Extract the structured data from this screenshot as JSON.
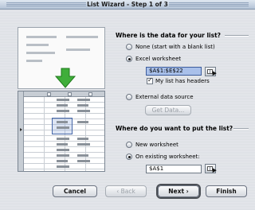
{
  "window": {
    "title": "List Wizard - Step 1 of 3"
  },
  "data_group": {
    "heading": "Where is the data for your list?",
    "options": {
      "none": "None (start with a blank list)",
      "excel": "Excel worksheet",
      "external": "External data source"
    },
    "selected": "excel",
    "range_value": "$A$1:$E$22",
    "headers_label": "My list has headers",
    "headers_checked": true,
    "get_data_label": "Get Data..."
  },
  "dest_group": {
    "heading": "Where do you want to put the list?",
    "options": {
      "new": "New worksheet",
      "existing": "On existing worksheet:"
    },
    "selected": "existing",
    "range_value": "$A$1"
  },
  "buttons": {
    "cancel": "Cancel",
    "back": "‹ Back",
    "next": "Next ›",
    "finish": "Finish"
  },
  "icons": {
    "arrow": "arrow-down-icon",
    "range_picker": "range-picker-icon"
  },
  "colors": {
    "arrow_green": "#3fae3a",
    "selection_blue": "#a9c0ea"
  }
}
